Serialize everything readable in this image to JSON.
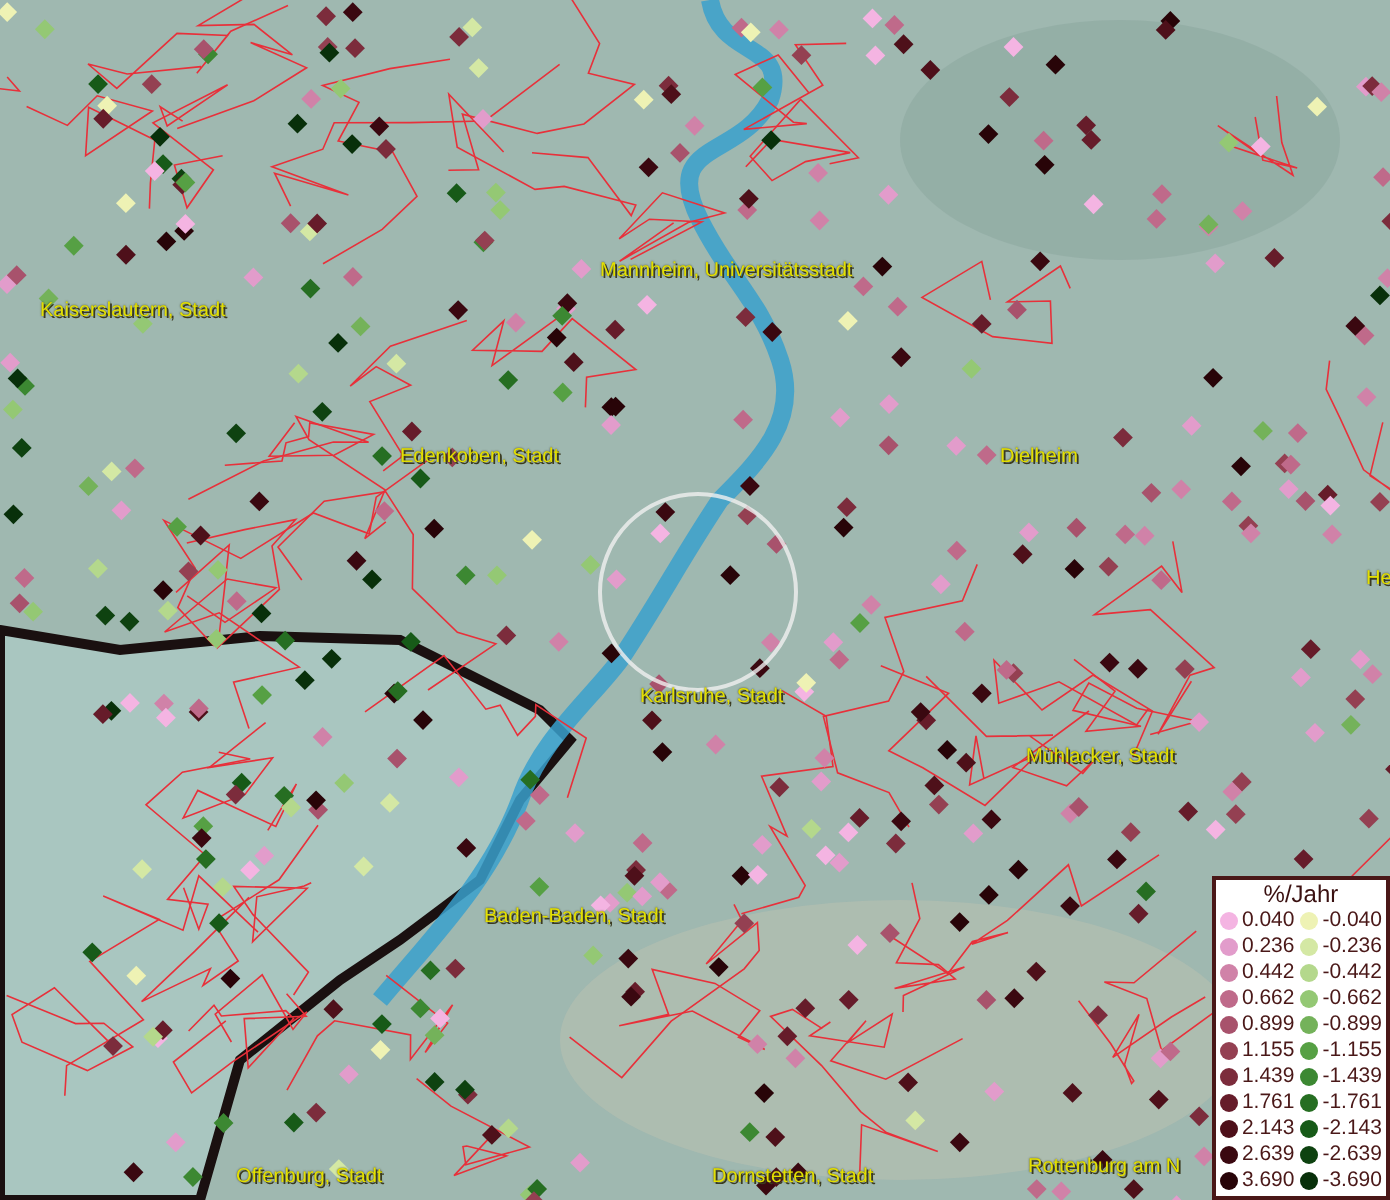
{
  "places": [
    {
      "name": "Kaiserslautern, Stadt"
    },
    {
      "name": "Mannheim, Universitätsstadt"
    },
    {
      "name": "Edenkoben, Stadt"
    },
    {
      "name": "Dielheim"
    },
    {
      "name": "He"
    },
    {
      "name": "Karlsruhe, Stadt"
    },
    {
      "name": "Mühlacker, Stadt"
    },
    {
      "name": "Baden-Baden, Stadt"
    },
    {
      "name": "Offenburg, Stadt"
    },
    {
      "name": "Dornstetten, Stadt"
    },
    {
      "name": "Rottenburg am N"
    }
  ],
  "legend": {
    "title": "%/Jahr",
    "rows": [
      {
        "left": {
          "value": "0.040",
          "color": "#f4b4e2"
        },
        "right": {
          "value": "-0.040",
          "color": "#eef2b4"
        }
      },
      {
        "left": {
          "value": "0.236",
          "color": "#e29ccb"
        },
        "right": {
          "value": "-0.236",
          "color": "#d4e8a4"
        }
      },
      {
        "left": {
          "value": "0.442",
          "color": "#d082a8"
        },
        "right": {
          "value": "-0.442",
          "color": "#b4d88c"
        }
      },
      {
        "left": {
          "value": "0.662",
          "color": "#bf6a8a"
        },
        "right": {
          "value": "-0.662",
          "color": "#94c874"
        }
      },
      {
        "left": {
          "value": "0.899",
          "color": "#a8526c"
        },
        "right": {
          "value": "-0.899",
          "color": "#74b25a"
        }
      },
      {
        "left": {
          "value": "1.155",
          "color": "#944052"
        },
        "right": {
          "value": "-1.155",
          "color": "#56a044"
        }
      },
      {
        "left": {
          "value": "1.439",
          "color": "#7c2c3c"
        },
        "right": {
          "value": "-1.439",
          "color": "#3c8832"
        }
      },
      {
        "left": {
          "value": "1.761",
          "color": "#661c2a"
        },
        "right": {
          "value": "-1.761",
          "color": "#266e22"
        }
      },
      {
        "left": {
          "value": "2.143",
          "color": "#4e101a"
        },
        "right": {
          "value": "-2.143",
          "color": "#175a18"
        }
      },
      {
        "left": {
          "value": "2.639",
          "color": "#3a0810"
        },
        "right": {
          "value": "-2.639",
          "color": "#0e4210"
        }
      },
      {
        "left": {
          "value": "3.690",
          "color": "#280408"
        },
        "right": {
          "value": "-3.690",
          "color": "#08300a"
        }
      }
    ]
  }
}
